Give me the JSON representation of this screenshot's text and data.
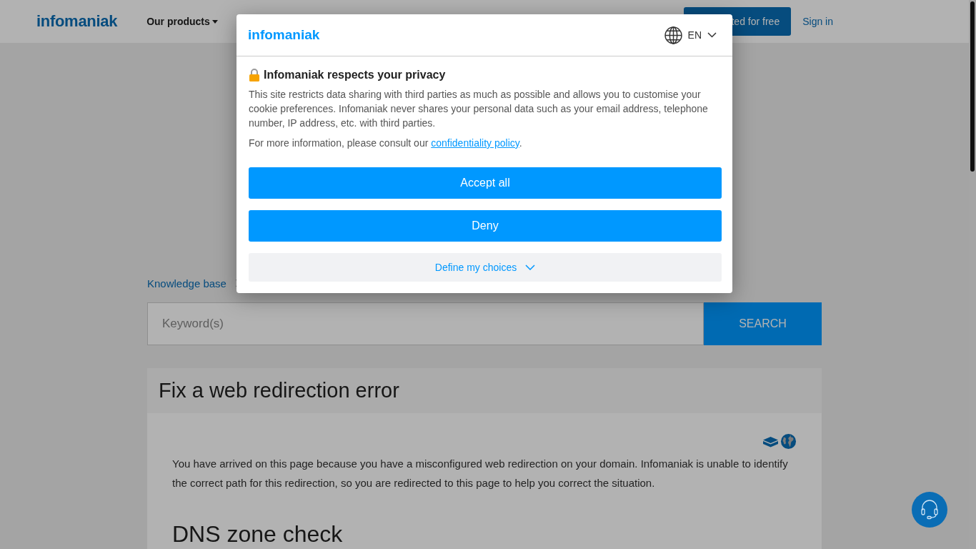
{
  "header": {
    "logo": "infomaniak",
    "nav": [
      {
        "label": "Our products"
      }
    ],
    "cta": "ted for free",
    "signin": "Sign in"
  },
  "breadcrumb": {
    "items": [
      "Knowledge base"
    ]
  },
  "search": {
    "placeholder": "Keyword(s)",
    "button": "SEARCH"
  },
  "article": {
    "title": "Fix a web redirection error",
    "intro": "You have arrived on this page because you have a misconfigured web redirection on your domain. Infomaniak is unable to identify the correct path for this redirection, so you are redirected to this page to help you correct the situation.",
    "section_heading": "DNS zone check"
  },
  "cookie_dialog": {
    "logo": "infomaniak",
    "language": "EN",
    "title": "Infomaniak respects your privacy",
    "text": "This site restricts data sharing with third parties as much as possible and allows you to customise your cookie preferences. Infomaniak never shares your personal data such as your email address, telephone number, IP address, etc. with third parties.",
    "more": {
      "before": "For more information, please consult our ",
      "link": "confidentiality policy",
      "after": "."
    },
    "buttons": [
      {
        "label": "Accept all",
        "kind": "primary"
      },
      {
        "label": "Deny",
        "kind": "primary"
      },
      {
        "label": "Define my choices",
        "kind": "secondary"
      }
    ]
  }
}
